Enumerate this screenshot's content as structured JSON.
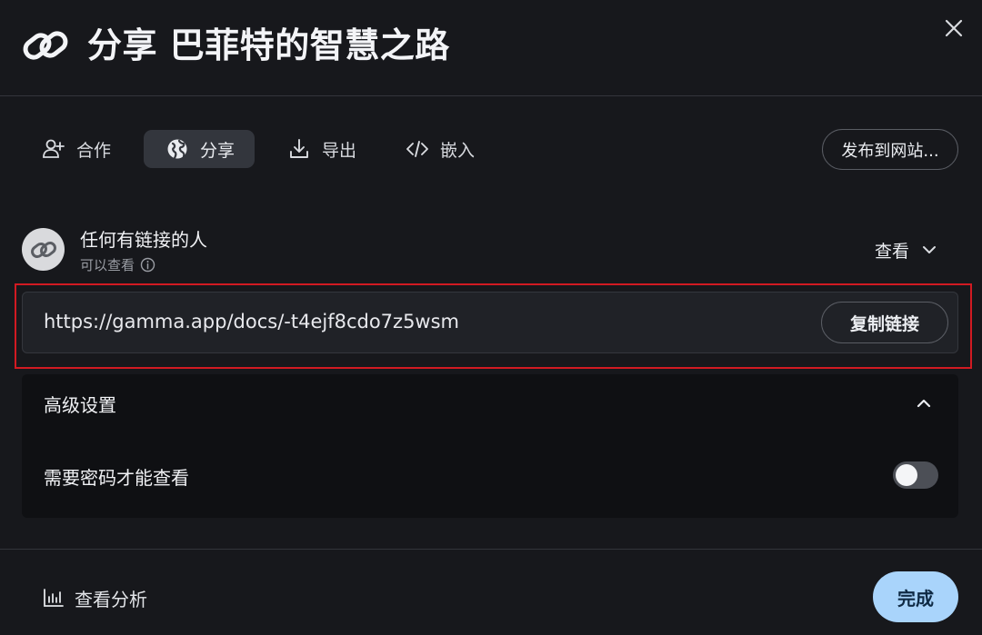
{
  "header": {
    "title": "分享 巴菲特的智慧之路",
    "icon": "link-icon",
    "close_icon": "close-icon"
  },
  "tabs": [
    {
      "label": "合作",
      "icon": "add-user-icon",
      "active": false
    },
    {
      "label": "分享",
      "icon": "globe-icon",
      "active": true
    },
    {
      "label": "导出",
      "icon": "download-icon",
      "active": false
    },
    {
      "label": "嵌入",
      "icon": "code-icon",
      "active": false
    }
  ],
  "publish_label": "发布到网站...",
  "access": {
    "title": "任何有链接的人",
    "subtitle": "可以查看",
    "permission": "查看"
  },
  "link": {
    "url": "https://gamma.app/docs/-t4ejf8cdo7z5wsm",
    "copy_label": "复制链接"
  },
  "advanced": {
    "title": "高级设置",
    "expanded": true,
    "password_label": "需要密码才能查看",
    "password_required": false
  },
  "footer": {
    "analytics_label": "查看分析",
    "done_label": "完成"
  },
  "colors": {
    "background": "#17181c",
    "active_tab": "#33363d",
    "done_button": "#a9d4fb",
    "highlight_border": "#d11a22"
  }
}
